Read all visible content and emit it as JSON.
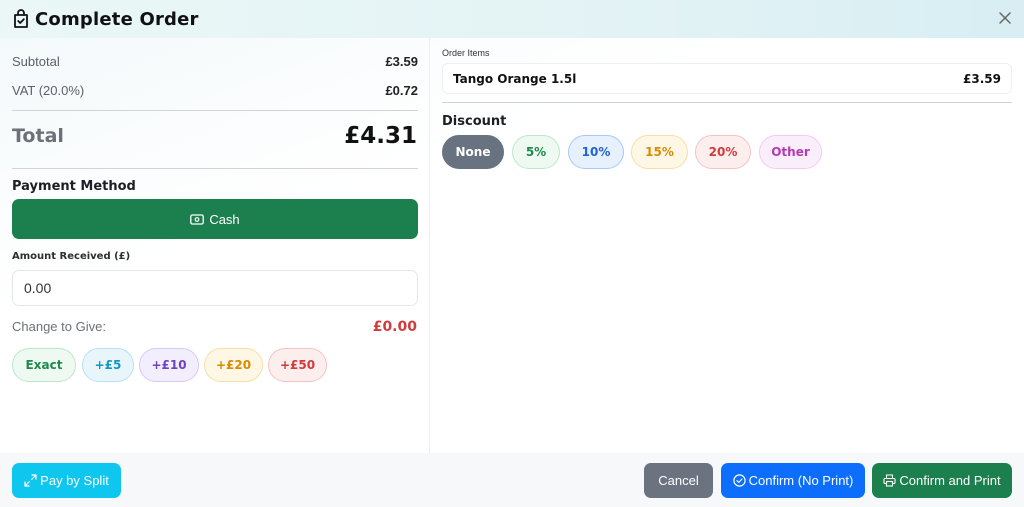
{
  "modal": {
    "title": "Complete Order"
  },
  "summary": {
    "subtotal_label": "Subtotal",
    "subtotal_value": "£3.59",
    "vat_label": "VAT (20.0%)",
    "vat_value": "£0.72",
    "total_label": "Total",
    "total_value": "£4.31"
  },
  "payment": {
    "title": "Payment Method",
    "method_label": "Cash",
    "amount_label": "Amount Received (£)",
    "amount_value": "0.00",
    "change_label": "Change to Give:",
    "change_value": "£0.00",
    "quick_amounts": [
      "Exact",
      "+£5",
      "+£10",
      "+£20",
      "+£50"
    ]
  },
  "order": {
    "items_label": "Order Items",
    "items": [
      {
        "name": "Tango Orange 1.5l",
        "price": "£3.59"
      }
    ]
  },
  "discount": {
    "title": "Discount",
    "options": [
      "None",
      "5%",
      "10%",
      "15%",
      "20%",
      "Other"
    ],
    "selected": "None"
  },
  "footer": {
    "split_label": "Pay by Split",
    "cancel_label": "Cancel",
    "confirm_no_print_label": "Confirm (No Print)",
    "confirm_print_label": "Confirm and Print"
  },
  "colors": {
    "cash_green": "#1c7f4e",
    "split_cyan": "#0fc7ee",
    "cancel_gray": "#6b7280",
    "confirm_blue": "#0d6efd",
    "change_red": "#d03b3b"
  }
}
